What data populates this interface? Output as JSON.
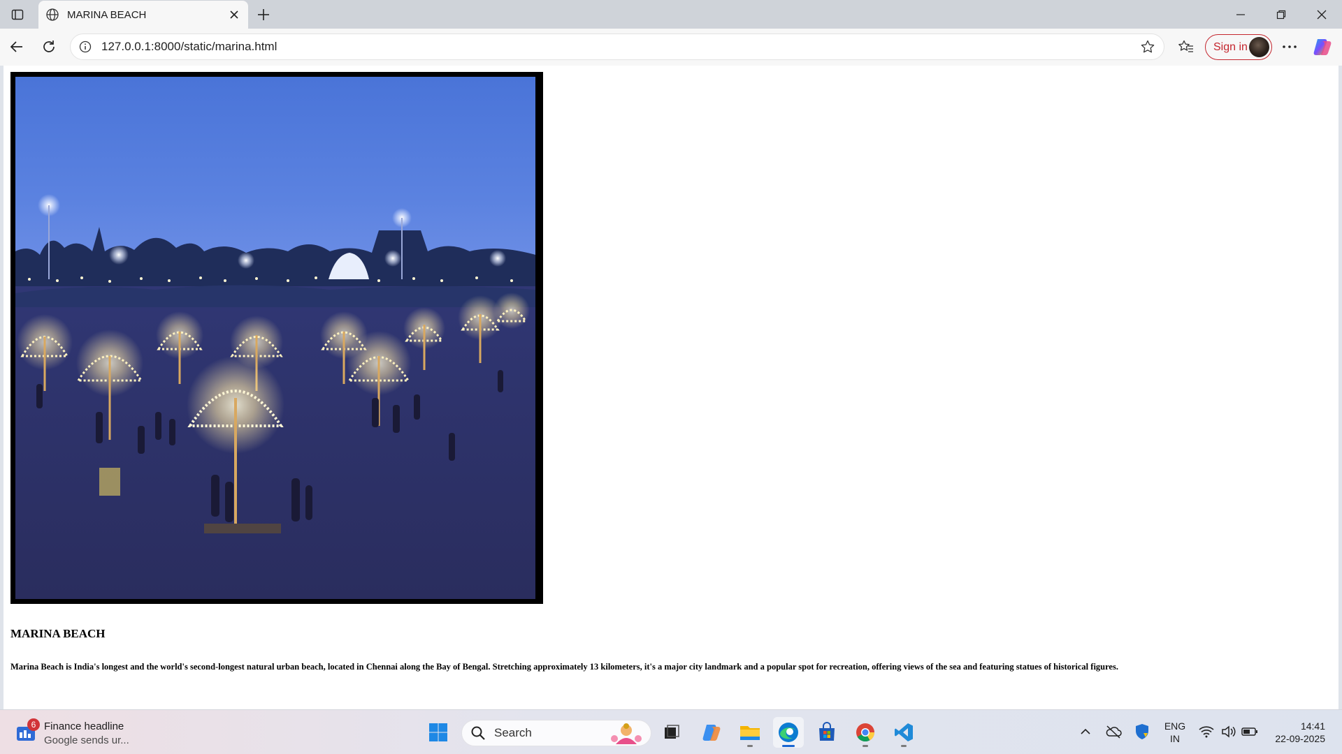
{
  "browser": {
    "tab_title": "MARINA BEACH",
    "url": "127.0.0.1:8000/static/marina.html",
    "signin_label": "Sign in"
  },
  "page": {
    "heading": "MARINA BEACH",
    "description": "Marina Beach is India's longest and the world's second-longest natural urban beach, located in Chennai along the Bay of Bengal. Stretching approximately 13 kilometers, it's a major city landmark and a popular spot for recreation, offering views of the sea and featuring statues of historical figures."
  },
  "taskbar": {
    "widget_title": "Finance headline",
    "widget_subtitle": "Google sends ur...",
    "widget_badge": "6",
    "search_placeholder": "Search",
    "language_line1": "ENG",
    "language_line2": "IN",
    "time": "14:41",
    "date": "22-09-2025",
    "apps": [
      "start-icon",
      "task-view-icon",
      "copilot-icon",
      "file-explorer-icon",
      "edge-icon",
      "microsoft-store-icon",
      "chrome-icon",
      "vscode-icon"
    ]
  },
  "colors": {
    "signin_accent": "#c4262e",
    "edge_accent": "#1a66d2",
    "photo_sky": "#4a74d8",
    "photo_sand": "#2f3570"
  }
}
